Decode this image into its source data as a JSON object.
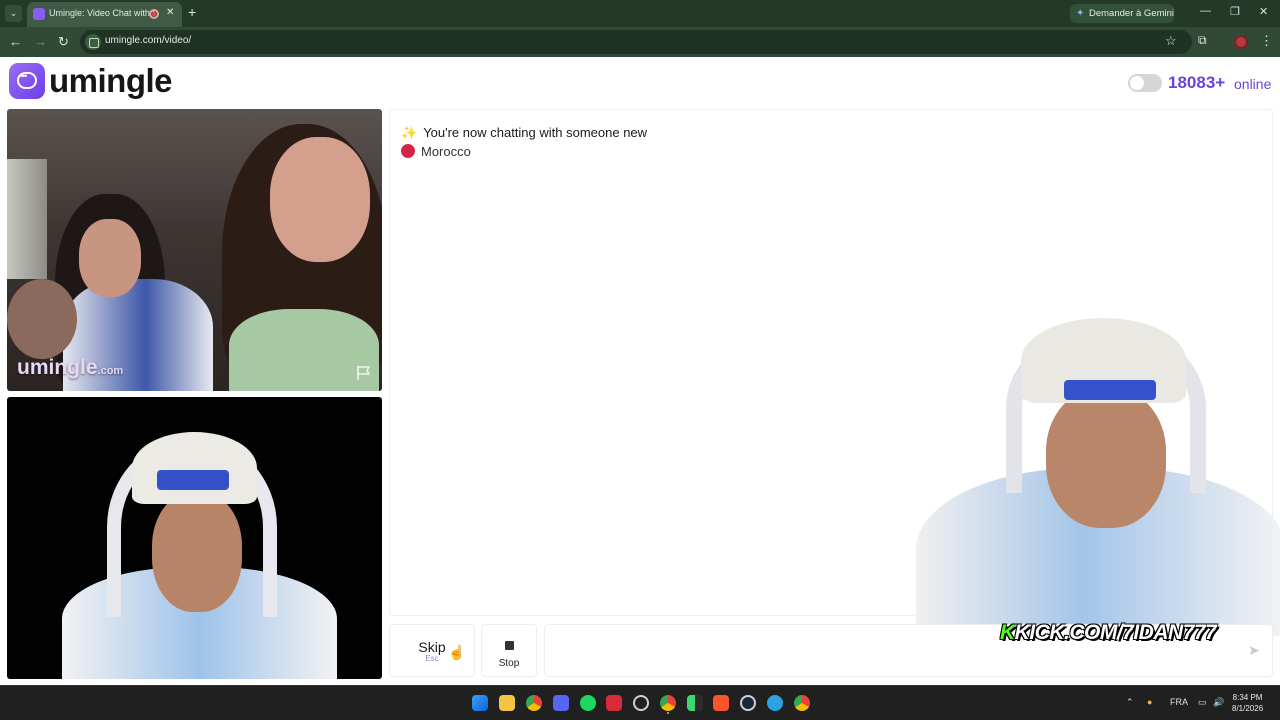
{
  "browser": {
    "tab_title": "Umingle: Video Chat with S",
    "url": "umingle.com/video/",
    "gemini_label": "Demander à Gemini"
  },
  "header": {
    "logo_text": "umingle",
    "online_count": "18083+",
    "online_label": "online"
  },
  "video": {
    "watermark": "umingle",
    "watermark_suffix": ".com"
  },
  "chat": {
    "system_message": "You're now chatting with someone new",
    "country": "Morocco"
  },
  "overlay": {
    "kick_k": "K",
    "kick_text": "KICK.COM/7IDAN777"
  },
  "controls": {
    "skip_label": "Skip",
    "skip_hint": "Esc",
    "stop_label": "Stop",
    "message_placeholder": ""
  },
  "taskbar": {
    "language": "FRA",
    "time": "8:34 PM",
    "date": "8/1/2026",
    "icons": [
      "windows-start",
      "file-explorer",
      "chrome",
      "discord",
      "spotify",
      "app-red",
      "app-circle",
      "chrome-active",
      "play-green",
      "brave",
      "steam",
      "telegram",
      "chrome-alt"
    ]
  },
  "colors": {
    "brand": "#6c43d9",
    "country_dot": "#d12745",
    "kick_green": "#53fc18"
  }
}
